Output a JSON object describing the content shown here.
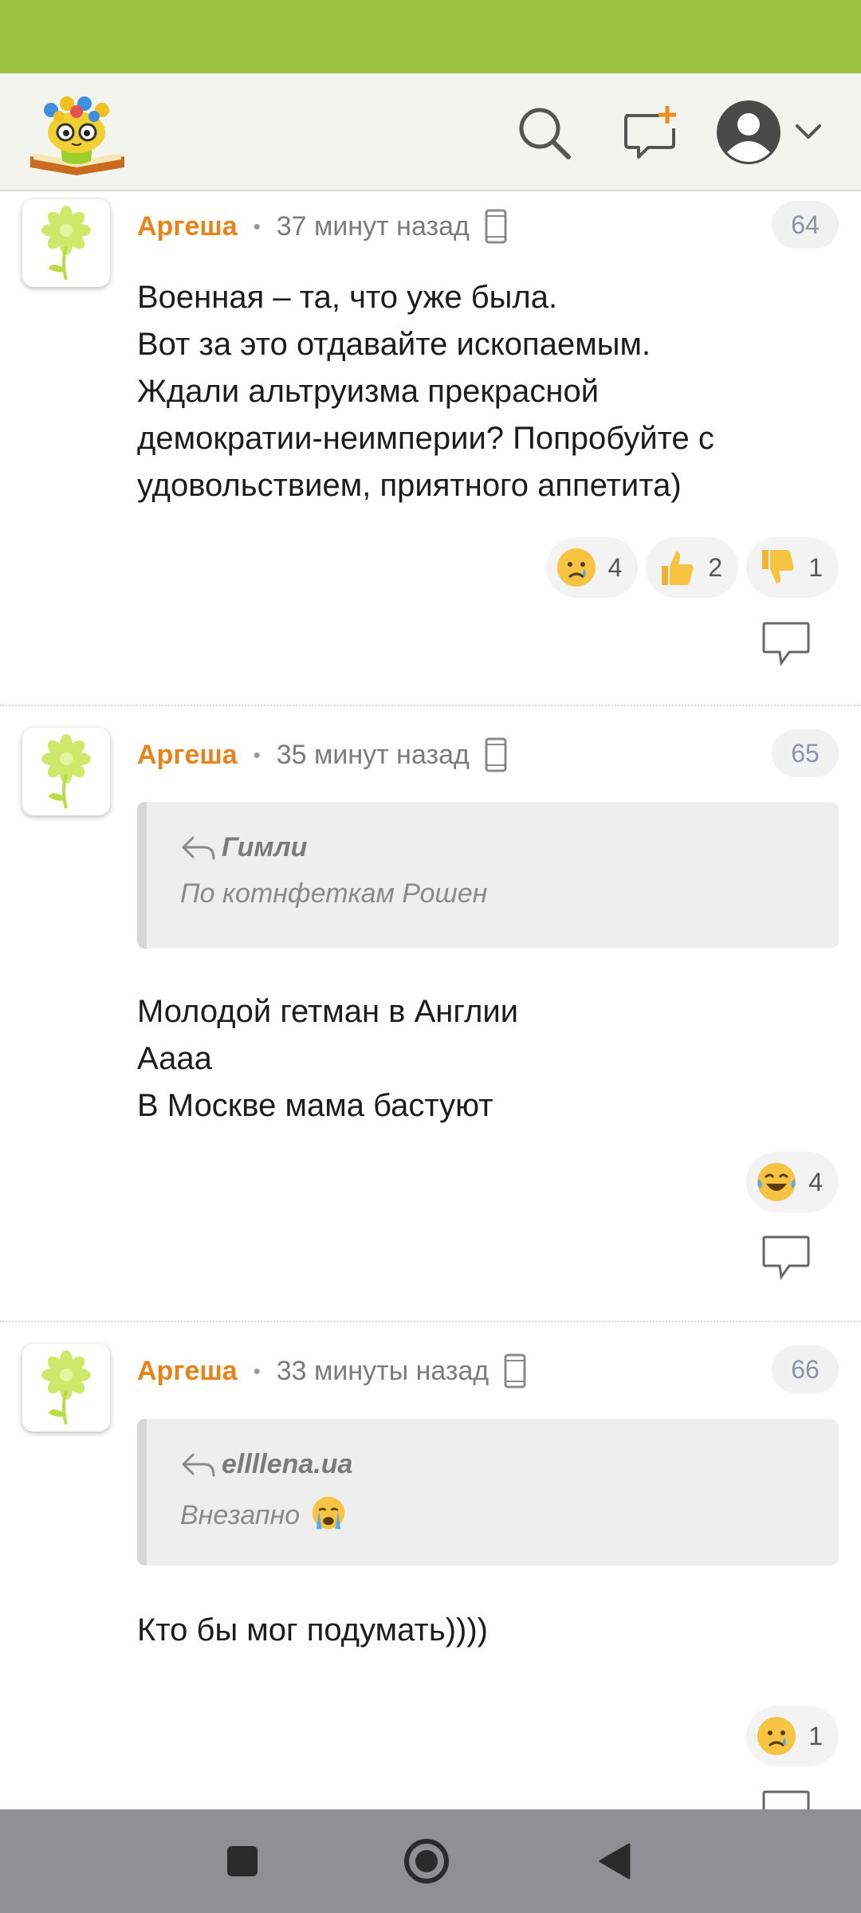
{
  "header": {
    "logo": "book-flower-logo",
    "icons": [
      "search-icon",
      "new-post-icon",
      "avatar-icon",
      "chevron-down-icon"
    ]
  },
  "comments": [
    {
      "author": "Аргеша",
      "time": "37 минут назад",
      "number": "64",
      "lines": [
        "Военная – та, что уже была.",
        "Вот за это отдавайте ископаемым.",
        "Ждали альтруизма прекрасной",
        "демократии-неимперии? Попробуйте с",
        "удовольствием, приятного аппетита)"
      ],
      "reactions": [
        {
          "emoji": "crying-face",
          "count": "4"
        },
        {
          "emoji": "thumbs-up",
          "count": "2"
        },
        {
          "emoji": "thumbs-down",
          "count": "1"
        }
      ]
    },
    {
      "author": "Аргеша",
      "time": "35 минут назад",
      "number": "65",
      "quote": {
        "author": "Гимли",
        "text": "По котнфеткам Рошен"
      },
      "lines": [
        "Молодой гетман в Англии",
        "Аааа",
        "В Москве мама бастуют"
      ],
      "reactions": [
        {
          "emoji": "tears-of-joy",
          "count": "4"
        }
      ]
    },
    {
      "author": "Аргеша",
      "time": "33 минуты назад",
      "number": "66",
      "quote": {
        "author": "ellllena.ua",
        "text": "Внезапно"
      },
      "lines": [
        "Кто бы мог подумать))))"
      ],
      "reactions": [
        {
          "emoji": "crying-face",
          "count": "1"
        }
      ]
    }
  ],
  "colors": {
    "status_bar": "#9dc244",
    "author": "#e8821a",
    "nav_bar": "#8f8f94"
  }
}
